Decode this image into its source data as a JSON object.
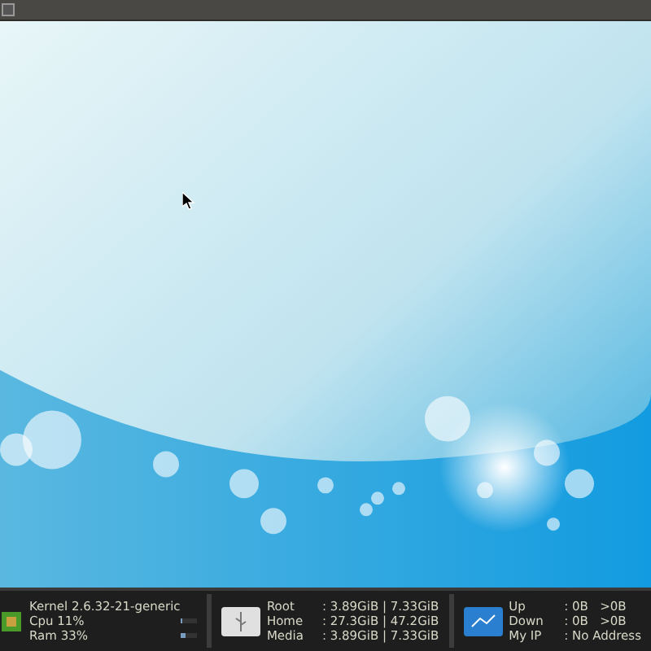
{
  "system": {
    "kernel": "Kernel 2.6.32-21-generic",
    "meters": [
      {
        "label": "Cpu 11%",
        "level": 0.11
      },
      {
        "label": "Ram 33%",
        "level": 0.33
      }
    ]
  },
  "drives": [
    {
      "name": "Root",
      "value": ": 3.89GiB | 7.33GiB"
    },
    {
      "name": "Home",
      "value": ": 27.3GiB | 47.2GiB"
    },
    {
      "name": "Media",
      "value": ": 3.89GiB | 7.33GiB"
    }
  ],
  "network": [
    {
      "name": "Up",
      "value": ": 0B   >0B"
    },
    {
      "name": "Down",
      "value": ": 0B   >0B"
    },
    {
      "name": "My IP",
      "value": ": No Address"
    }
  ]
}
